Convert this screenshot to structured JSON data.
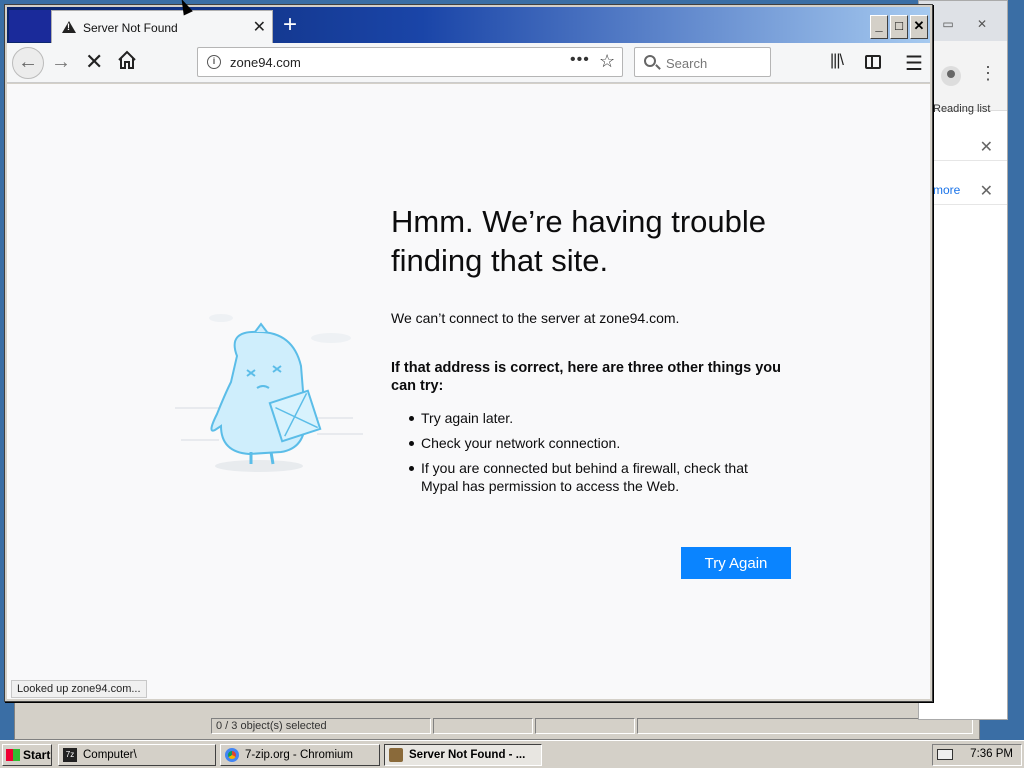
{
  "explorer": {
    "status_items": [
      "0 / 3 object(s) selected",
      "",
      "",
      "",
      ""
    ]
  },
  "chromium": {
    "reading_list_label": "Reading list",
    "more_link": "more"
  },
  "browser": {
    "tab": {
      "title": "Server Not Found"
    },
    "url": "zone94.com",
    "search_placeholder": "Search",
    "status_text": "Looked up zone94.com..."
  },
  "error_page": {
    "title": "Hmm. We’re having trouble finding that site.",
    "message": "We can’t connect to the server at zone94.com.",
    "subtitle": "If that address is correct, here are three other things you can try:",
    "suggestions": [
      "Try again later.",
      "Check your network connection.",
      "If you are connected but behind a firewall, check that Mypal has permission to access the Web."
    ],
    "button_label": "Try Again",
    "button_color": "#0a84ff"
  },
  "taskbar": {
    "start_label": "Start",
    "buttons": [
      {
        "label": "Computer\\",
        "icon": "7zip-icon"
      },
      {
        "label": "7-zip.org - Chromium",
        "icon": "chromium-icon"
      },
      {
        "label": "Server Not Found - ...",
        "icon": "mypal-icon"
      }
    ],
    "clock": "7:36 PM"
  }
}
